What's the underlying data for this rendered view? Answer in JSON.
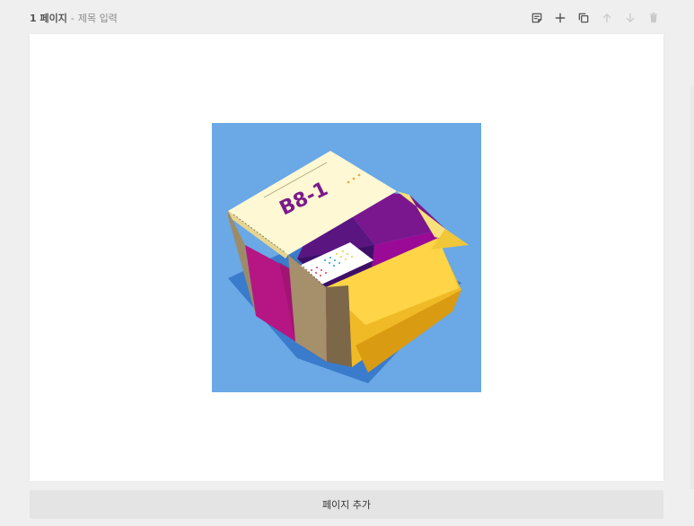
{
  "page": {
    "number": "1 페이지",
    "separator": "-",
    "title_placeholder": "제목 입력"
  },
  "toolbar": {
    "icons": [
      "note-icon",
      "plus-icon",
      "copy-icon",
      "arrow-up-icon",
      "arrow-down-icon",
      "trash-icon"
    ]
  },
  "canvas": {
    "image_text": "B8-1",
    "background_color": "#6aa8e6"
  },
  "footer": {
    "add_page_label": "페이지 추가"
  }
}
